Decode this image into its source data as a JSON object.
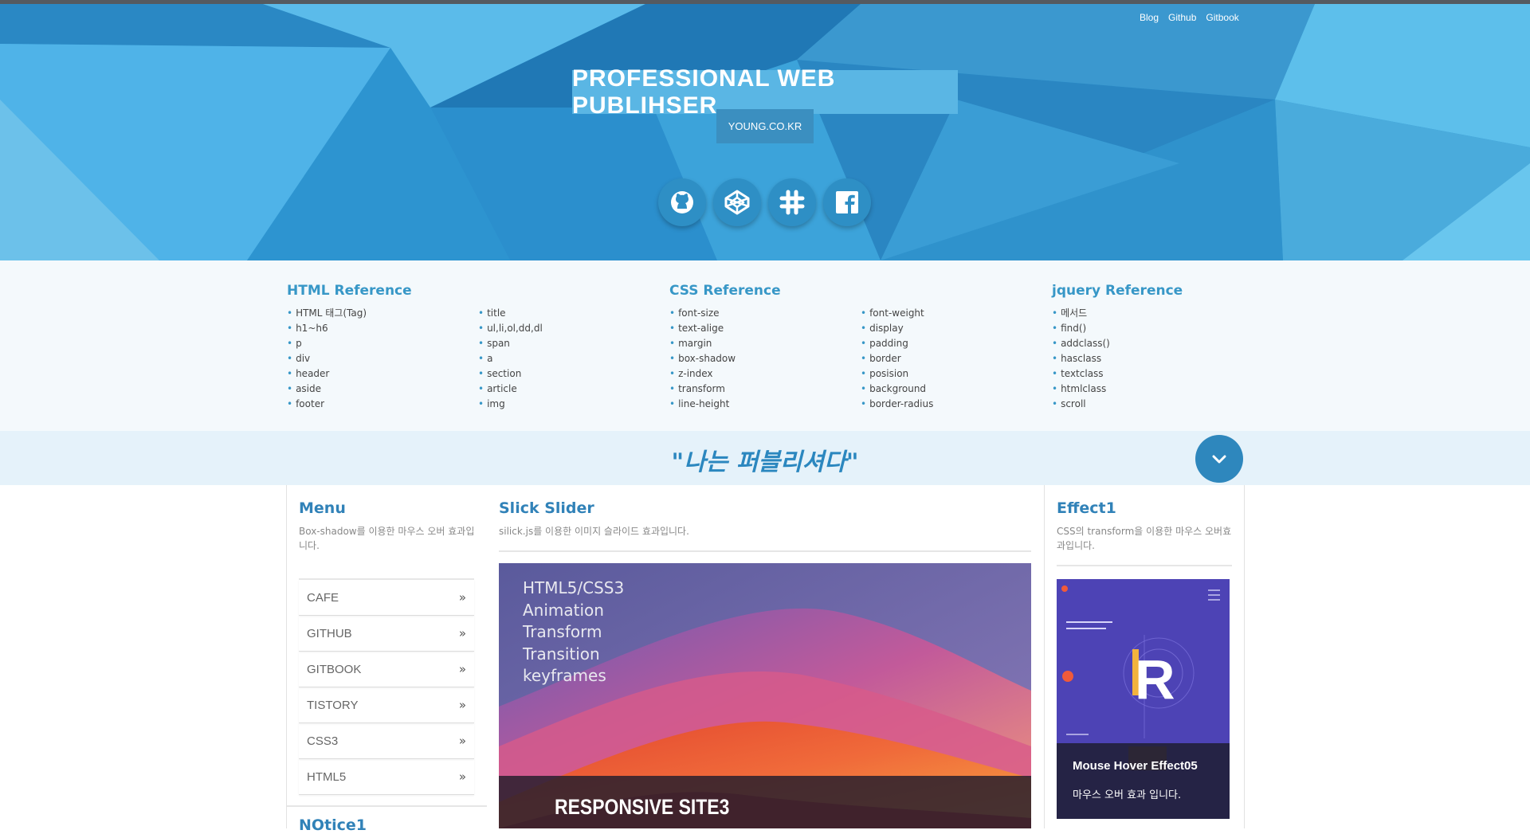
{
  "header": {
    "top_links": [
      "Blog",
      "Github",
      "Gitbook"
    ],
    "title": "PROFESSIONAL WEB PUBLIHSER",
    "subtitle": "YOUNG.CO.KR",
    "social_icons": [
      "github-icon",
      "codepen-icon",
      "slack-icon",
      "facebook-icon"
    ]
  },
  "reference": {
    "html_title": "HTML Reference",
    "html_col1": [
      "HTML 태그(Tag)",
      "h1~h6",
      "p",
      "div",
      "header",
      "aside",
      "footer"
    ],
    "html_col2": [
      "title",
      "ul,li,ol,dd,dl",
      "span",
      "a",
      "section",
      "article",
      "img"
    ],
    "css_title": "CSS Reference",
    "css_col1": [
      "font-size",
      "text-alige",
      "margin",
      "box-shadow",
      "z-index",
      "transform",
      "line-height"
    ],
    "css_col2": [
      "font-weight",
      "display",
      "padding",
      "border",
      "posision",
      "background",
      "border-radius"
    ],
    "jquery_title": "jquery Reference",
    "jquery_col1": [
      "메서드",
      "find()",
      "addclass()",
      "hasclass",
      "textclass",
      "htmlclass",
      "scroll"
    ]
  },
  "slogan": {
    "text": "\"나는 퍼블리셔다\""
  },
  "menu": {
    "title": "Menu",
    "desc": "Box-shadow를 이용한 마우스 오버 효과입니다.",
    "items": [
      "CAFE",
      "GITHUB",
      "GITBOOK",
      "TISTORY",
      "CSS3",
      "HTML5"
    ],
    "arrow": "»",
    "notice_title": "NOtice1"
  },
  "slider": {
    "title": "Slick Slider",
    "desc": "silick.js를 이용한 이미지 슬라이드 효과입니다.",
    "slide_lines": [
      "HTML5/CSS3",
      "Animation",
      "Transform",
      "Transition",
      "keyframes"
    ],
    "caption": "RESPONSIVE SITE3"
  },
  "effect": {
    "title": "Effect1",
    "desc": "CSS의 transform을 이용한 마우스 오버효과입니다.",
    "card_title": "Mouse Hover Effect05",
    "card_sub": "마우스 오버 효과 입니다.",
    "poster_letter": "R"
  },
  "colors": {
    "hero_blue": "#2f9ad3",
    "accent": "#3797c7",
    "slogan_bg": "#e5f2fa"
  }
}
